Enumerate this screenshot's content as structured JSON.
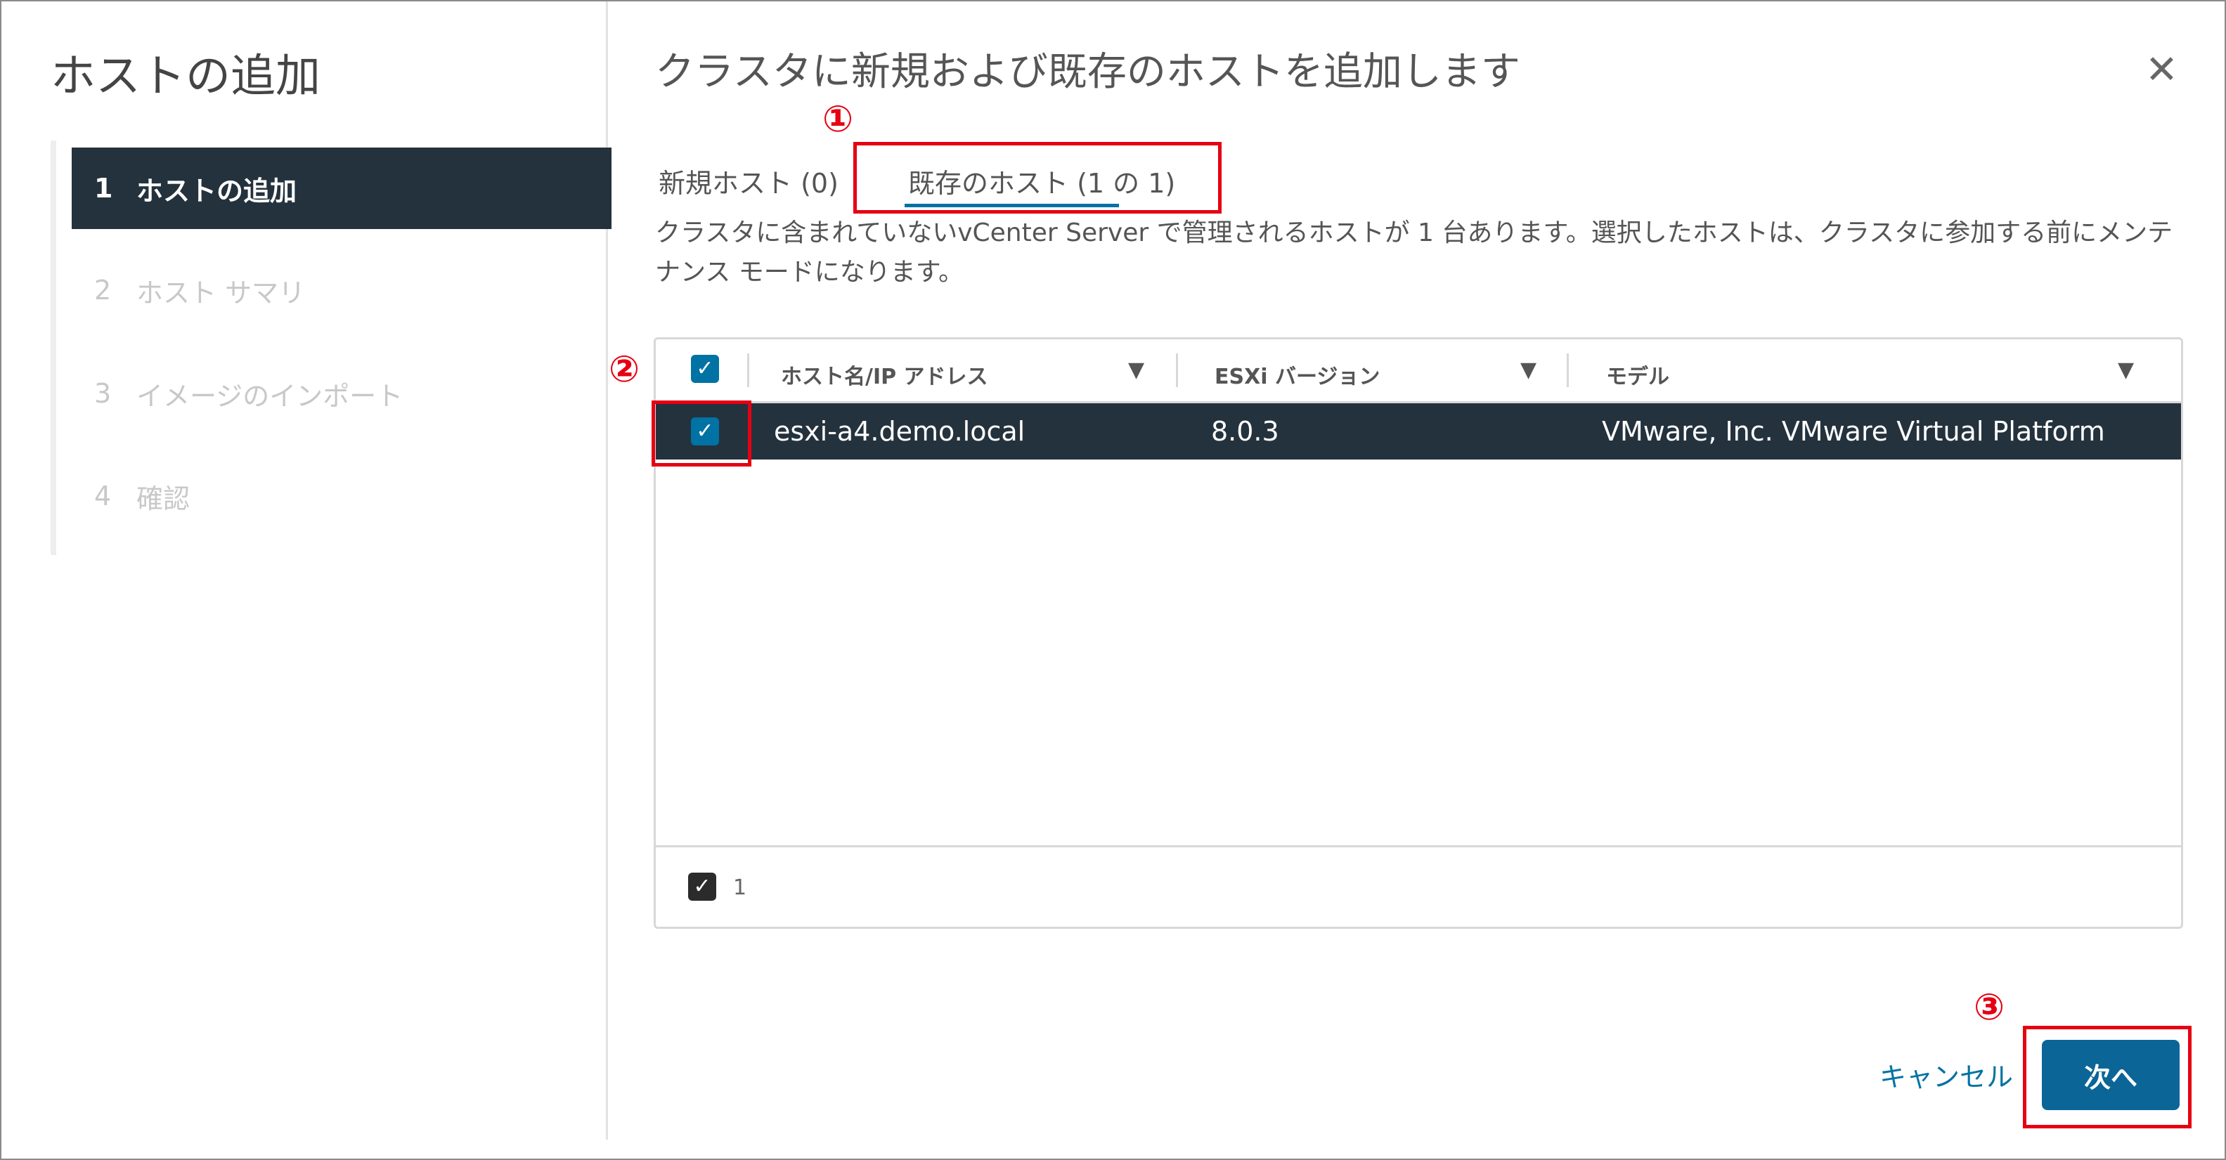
{
  "sidebar": {
    "title": "ホストの追加",
    "steps": [
      {
        "num": "1",
        "label": "ホストの追加"
      },
      {
        "num": "2",
        "label": "ホスト サマリ"
      },
      {
        "num": "3",
        "label": "イメージのインポート"
      },
      {
        "num": "4",
        "label": "確認"
      }
    ]
  },
  "main": {
    "title": "クラスタに新規および既存のホストを追加します",
    "close_icon": "close-icon",
    "tabs": [
      {
        "label": "新規ホスト (0)"
      },
      {
        "label": "既存のホスト (1 の 1)"
      }
    ],
    "description": "クラスタに含まれていないvCenter Server で管理されるホストが 1 台あります。選択したホストは、クラスタに参加する前にメンテナンス モードになります。",
    "grid": {
      "columns": [
        "ホスト名/IP アドレス",
        "ESXi バージョン",
        "モデル"
      ],
      "rows": [
        {
          "host": "esxi-a4.demo.local",
          "version": "8.0.3",
          "model": "VMware, Inc. VMware Virtual Platform"
        }
      ],
      "selected_count": "1"
    }
  },
  "annotations": {
    "m1": "①",
    "m2": "②",
    "m3": "③"
  },
  "buttons": {
    "cancel": "キャンセル",
    "next": "次へ"
  },
  "colors": {
    "accent": "#0072a3",
    "row_selected": "#24323d",
    "annotation": "#e60012"
  }
}
